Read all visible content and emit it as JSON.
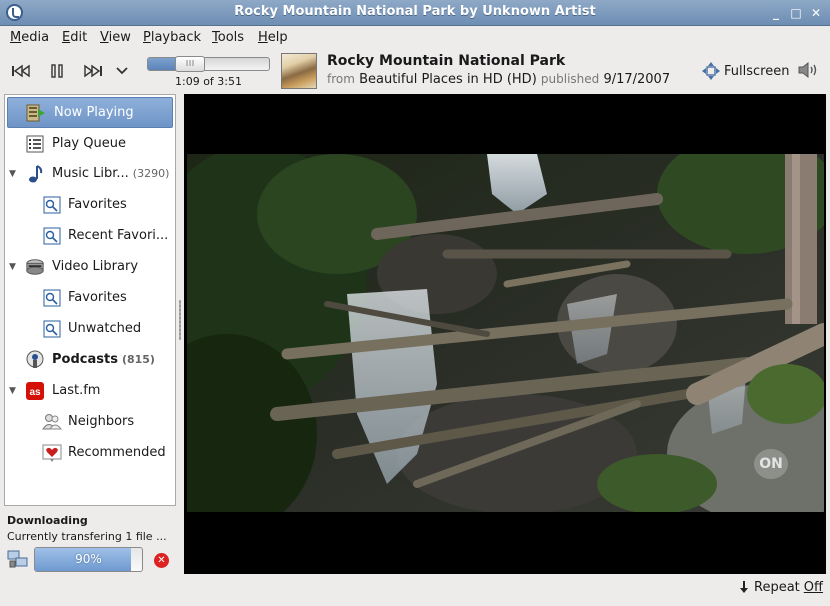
{
  "window": {
    "title": "Rocky Mountain National Park by Unknown Artist"
  },
  "menu": [
    "Media",
    "Edit",
    "View",
    "Playback",
    "Tools",
    "Help"
  ],
  "player": {
    "time_label": "1:09 of 3:51",
    "progress": 0.3,
    "track_title": "Rocky Mountain National Park",
    "from_label": "from",
    "album": "Beautiful Places in HD (HD)",
    "published_label": "published",
    "published_date": "9/17/2007",
    "fullscreen_label": "Fullscreen"
  },
  "sidebar": {
    "items": [
      {
        "label": "Now Playing",
        "icon": "now-playing-icon",
        "selected": true
      },
      {
        "label": "Play Queue",
        "icon": "play-queue-icon"
      },
      {
        "label": "Music Libr...",
        "count": "(3290)",
        "icon": "music-note-icon",
        "expandable": true
      },
      {
        "label": "Favorites",
        "icon": "smart-playlist-icon"
      },
      {
        "label": "Recent Favori...",
        "icon": "smart-playlist-icon"
      },
      {
        "label": "Video Library",
        "icon": "film-reel-icon",
        "expandable": true
      },
      {
        "label": "Favorites",
        "icon": "smart-playlist-icon"
      },
      {
        "label": "Unwatched",
        "icon": "smart-playlist-icon"
      },
      {
        "label": "Podcasts",
        "count": "(815)",
        "icon": "podcast-icon"
      },
      {
        "label": "Last.fm",
        "icon": "lastfm-icon",
        "expandable": true
      },
      {
        "label": "Neighbors",
        "icon": "neighbors-icon"
      },
      {
        "label": "Recommended",
        "icon": "heart-icon"
      }
    ]
  },
  "download": {
    "title": "Downloading",
    "status": "Currently transfering 1 file ...",
    "percent_label": "90%",
    "progress": 0.9
  },
  "video": {
    "overlay_badge": "ON"
  },
  "status_bar": {
    "repeat_label": "Repeat",
    "repeat_value": "Off"
  }
}
